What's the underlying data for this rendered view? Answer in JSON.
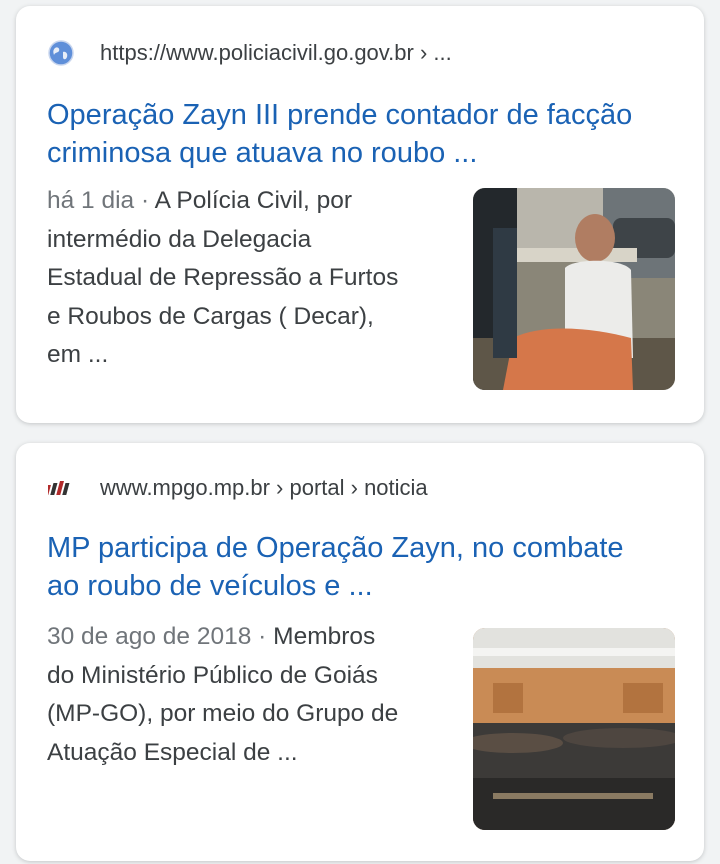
{
  "results": [
    {
      "source_url": "https://www.policiacivil.go.gov.br › ...",
      "favicon": "globe-icon",
      "title_line1": "Operação Zayn III prende contador de facção",
      "title_line2": "criminosa que atuava no roubo ...",
      "date": "há 1 dia",
      "separator": " · ",
      "snippet_lines": [
        "A Polícia Civil, por",
        "intermédio da Delegacia",
        "Estadual de Repressão a Furtos",
        "e Roubos de Cargas ( Decar),",
        "em ..."
      ],
      "thumbnail": "arrested-man-photo"
    },
    {
      "source_url": "www.mpgo.mp.br › portal › noticia",
      "favicon": "mpgo-logo-icon",
      "title_line1": "MP participa de Operação Zayn, no combate",
      "title_line2": "ao roubo de veículos e ...",
      "date": "30 de ago de 2018",
      "separator": " · ",
      "snippet_lines": [
        "Membros",
        "do Ministério Público de Goiás",
        "(MP-GO), por meio do Grupo de",
        "Atuação Especial de ..."
      ],
      "thumbnail": "auditorium-photo"
    }
  ],
  "colors": {
    "link": "#1a62b4",
    "text": "#3c4043",
    "muted": "#70757a",
    "background": "#f1f3f4"
  }
}
